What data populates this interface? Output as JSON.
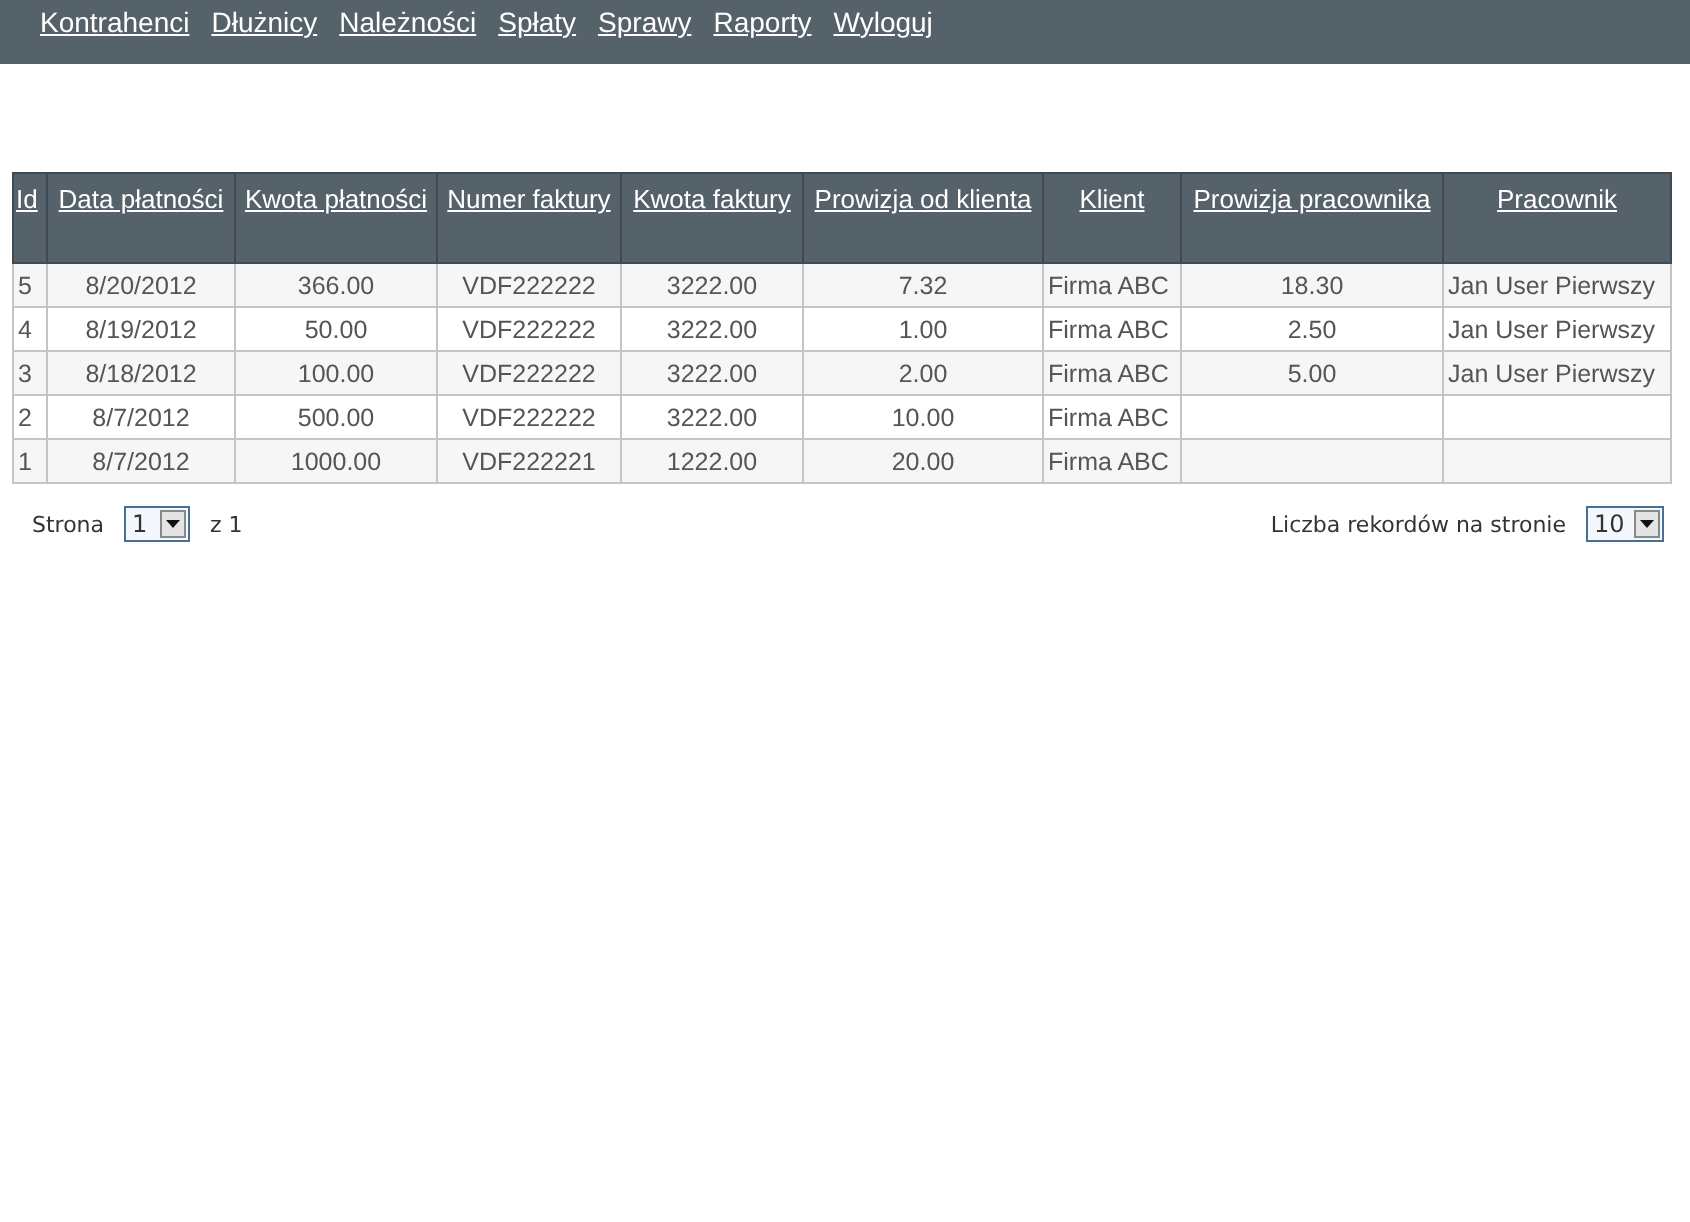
{
  "nav": {
    "items": [
      "Kontrahenci",
      "Dłużnicy",
      "Należności",
      "Spłaty",
      "Sprawy",
      "Raporty",
      "Wyloguj"
    ]
  },
  "table": {
    "columns": [
      "Id",
      "Data płatności",
      "Kwota płatności",
      "Numer faktury",
      "Kwota faktury",
      "Prowizja od klienta",
      "Klient",
      "Prowizja pracownika",
      "Pracownik"
    ],
    "rows": [
      {
        "cells": [
          "5",
          "8/20/2012",
          "366.00",
          "VDF222222",
          "3222.00",
          "7.32",
          "Firma ABC",
          "18.30",
          "Jan User Pierwszy"
        ]
      },
      {
        "cells": [
          "4",
          "8/19/2012",
          "50.00",
          "VDF222222",
          "3222.00",
          "1.00",
          "Firma ABC",
          "2.50",
          "Jan User Pierwszy"
        ]
      },
      {
        "cells": [
          "3",
          "8/18/2012",
          "100.00",
          "VDF222222",
          "3222.00",
          "2.00",
          "Firma ABC",
          "5.00",
          "Jan User Pierwszy"
        ]
      },
      {
        "cells": [
          "2",
          "8/7/2012",
          "500.00",
          "VDF222222",
          "3222.00",
          "10.00",
          "Firma ABC"
        ]
      },
      {
        "cells": [
          "1",
          "8/7/2012",
          "1000.00",
          "VDF222221",
          "1222.00",
          "20.00",
          "Firma ABC"
        ]
      }
    ]
  },
  "pager": {
    "page_label": "Strona",
    "page_value": "1",
    "page_total": "z 1",
    "size_label": "Liczba rekordów na stronie",
    "size_value": "10"
  }
}
